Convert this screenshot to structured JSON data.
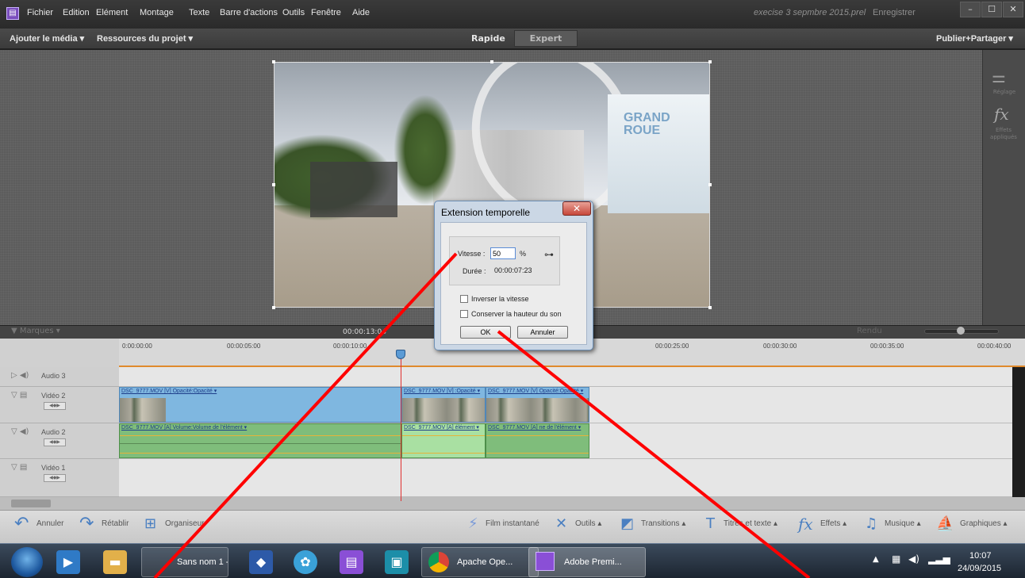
{
  "app": {
    "menu": [
      "Fichier",
      "Edition",
      "Elément",
      "Montage",
      "Texte",
      "Barre d'actions",
      "Outils",
      "Fenêtre",
      "Aide"
    ],
    "project_title": "execise 3 sepmbre 2015.prel",
    "save_label": "Enregistrer",
    "window_buttons": [
      "–",
      "☐",
      "✕"
    ]
  },
  "subbar": {
    "add_media": "Ajouter le média ▾",
    "project_assets": "Ressources du projet ▾",
    "mode_quick": "Rapide",
    "mode_expert": "Expert",
    "publish": "Publier+Partager ▾"
  },
  "right_panel": {
    "adjust_label": "Réglage",
    "effects_label": "Effets appliqués"
  },
  "frame": {
    "sign_line1": "GRAND",
    "sign_line2": "ROUE"
  },
  "dialog": {
    "title": "Extension temporelle",
    "close": "✕",
    "speed_label": "Vitesse :",
    "speed_value": "50",
    "speed_unit": "%",
    "duration_label": "Durée :",
    "duration_value": "00:00:07:23",
    "reverse_speed": "Inverser la vitesse",
    "keep_pitch": "Conserver la hauteur du son",
    "ok": "OK",
    "cancel": "Annuler"
  },
  "timeline": {
    "markers": "▼ Marques ▾",
    "current_time": "00:00:13:04",
    "render": "Rendu",
    "ticks": [
      "0:00:00:00",
      "00:00:05:00",
      "00:00:10:00",
      "00:00:25:00",
      "00:00:30:00",
      "00:00:35:00",
      "00:00:40:00"
    ],
    "tracks": {
      "audio3": "Audio 3",
      "video2": "Vidéo 2",
      "audio2": "Audio 2",
      "video1": "Vidéo 1"
    },
    "clips": {
      "v1": "DSC_9777.MOV [V]  Opacité:Opacité ▾",
      "v2": "DSC_9777.MOV [V]  :Opacité ▾",
      "v3": "DSC_9777.MOV [V]  Opacité:Opacité ▾",
      "a1": "DSC_9777.MOV [A]  Volume:Volume de l'élément ▾",
      "a2": "DSC_9777.MOV [A]  élément ▾",
      "a3": "DSC_9777.MOV [A]  ne de l'élément ▾"
    }
  },
  "bottombar": {
    "undo": "Annuler",
    "redo": "Rétablir",
    "organizer": "Organiseur",
    "instant_movie": "Film instantané",
    "tools": "Outils ▴",
    "transitions": "Transitions ▴",
    "titles": "Titres et texte ▴",
    "effects": "Effets ▴",
    "music": "Musique ▴",
    "graphics": "Graphiques ▴"
  },
  "taskbar": {
    "item_sansnom": "Sans nom 1 -...",
    "item_chrome": "Apache Ope...",
    "item_premiere": "Adobe Premi...",
    "time": "10:07",
    "date": "24/09/2015"
  },
  "colors": {
    "annotation": "#ff0000",
    "video_clip": "#7fb7e0",
    "audio_clip": "#7fbd7b",
    "playhead": "#e03030"
  }
}
